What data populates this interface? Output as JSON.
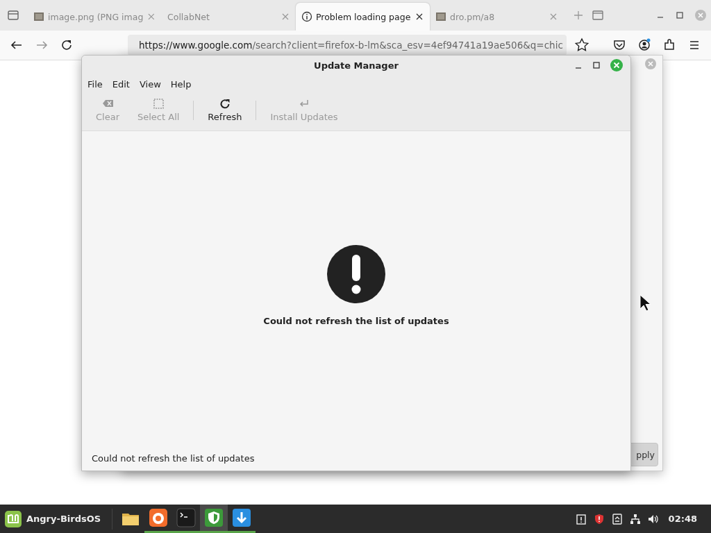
{
  "browser": {
    "tabs": [
      {
        "label": "image.png (PNG imag",
        "kind": "image",
        "selected": false
      },
      {
        "label": "CollabNet",
        "kind": "none",
        "selected": false
      },
      {
        "label": "Problem loading page",
        "kind": "info",
        "selected": true
      },
      {
        "label": "dro.pm/a8",
        "kind": "image",
        "selected": false
      }
    ],
    "url_host": "https://www.google.com",
    "url_path": "/search?client=firefox-b-lm&sca_esv=4ef94741a19ae506&q=chic"
  },
  "background_dialog": {
    "button": "pply"
  },
  "update_manager": {
    "title": "Update Manager",
    "menu": [
      "File",
      "Edit",
      "View",
      "Help"
    ],
    "toolbar": [
      {
        "label": "Clear",
        "kind": "clear",
        "disabled": true
      },
      {
        "label": "Select All",
        "kind": "select",
        "disabled": true
      },
      {
        "label": "Refresh",
        "kind": "refresh",
        "disabled": false
      },
      {
        "label": "Install Updates",
        "kind": "install",
        "disabled": true
      }
    ],
    "message": "Could not refresh the list of updates",
    "status": "Could not refresh the list of updates"
  },
  "taskbar": {
    "menu_label": "Angry-BirdsOS",
    "apps": [
      {
        "kind": "files",
        "running": false,
        "selected": false
      },
      {
        "kind": "browser",
        "running": true,
        "selected": false
      },
      {
        "kind": "terminal",
        "running": true,
        "selected": false
      },
      {
        "kind": "shield",
        "running": true,
        "selected": true
      },
      {
        "kind": "download",
        "running": true,
        "selected": false
      }
    ],
    "clock": "02:48"
  }
}
